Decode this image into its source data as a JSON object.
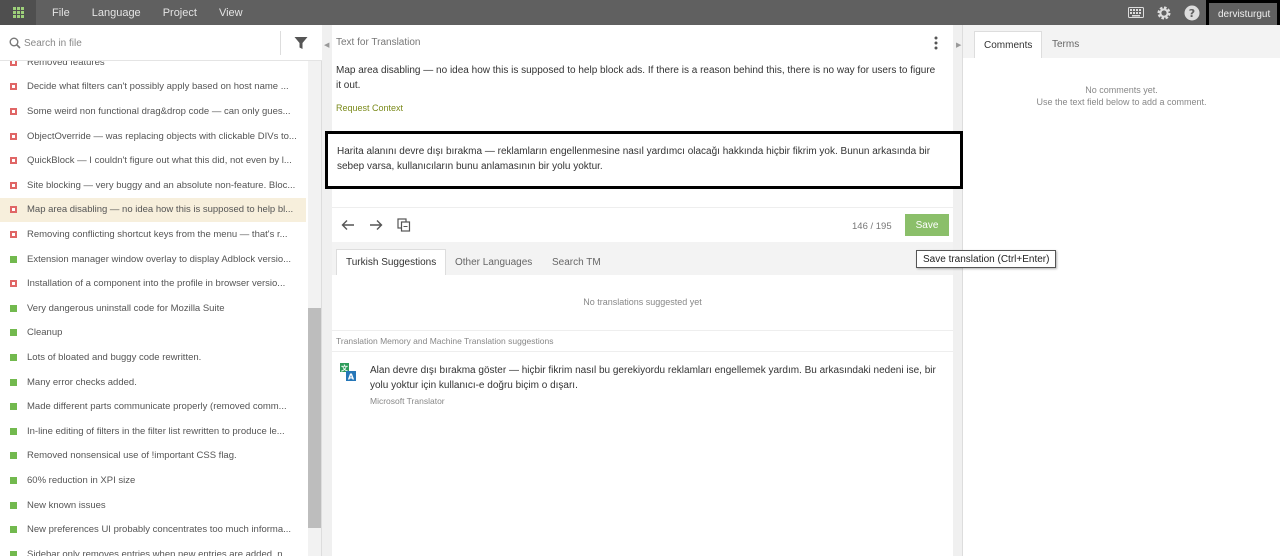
{
  "menu": [
    "File",
    "Language",
    "Project",
    "View"
  ],
  "user": {
    "name": "dervisturgut"
  },
  "colors": {
    "accent": "#8bbf6a",
    "topbar": "#606060",
    "error_dot": "#e06666",
    "ok_dot": "#72b94e"
  },
  "sidebar": {
    "search_placeholder": "Search in file",
    "items": [
      {
        "status": "error",
        "text": "Removed features"
      },
      {
        "status": "error",
        "text": "Decide what filters can't possibly apply based on host name ..."
      },
      {
        "status": "error",
        "text": "Some weird non functional drag&drop code — can only gues..."
      },
      {
        "status": "error",
        "text": "ObjectOverride — was replacing objects with clickable DIVs to..."
      },
      {
        "status": "error",
        "text": "QuickBlock — I couldn't figure out what this did, not even by l..."
      },
      {
        "status": "error",
        "text": "Site blocking — very buggy and an absolute non-feature. Bloc..."
      },
      {
        "status": "error",
        "text": "Map area disabling — no idea how this is supposed to help bl...",
        "selected": true
      },
      {
        "status": "error",
        "text": "Removing conflicting shortcut keys from the menu — that's r..."
      },
      {
        "status": "ok",
        "text": "Extension manager window overlay to display Adblock versio..."
      },
      {
        "status": "error",
        "text": "Installation of a component into the profile in browser versio..."
      },
      {
        "status": "ok",
        "text": "Very dangerous uninstall code for Mozilla Suite"
      },
      {
        "status": "ok",
        "text": "Cleanup"
      },
      {
        "status": "ok",
        "text": "Lots of bloated and buggy code rewritten."
      },
      {
        "status": "ok",
        "text": "Many error checks added."
      },
      {
        "status": "ok",
        "text": "Made different parts communicate properly (removed comm..."
      },
      {
        "status": "ok",
        "text": "In-line editing of filters in the filter list rewritten to produce le..."
      },
      {
        "status": "ok",
        "text": "Removed nonsensical use of !important CSS flag."
      },
      {
        "status": "ok",
        "text": "60% reduction in XPI size"
      },
      {
        "status": "ok",
        "text": "New known issues"
      },
      {
        "status": "ok",
        "text": "New preferences UI probably concentrates too much informa..."
      },
      {
        "status": "ok",
        "text": "Sidebar only removes entries when new entries are added, n..."
      }
    ]
  },
  "editor": {
    "source_header": "Text for Translation",
    "source_text": "Map area disabling — no idea how this is supposed to help block ads. If there is a reason behind this, there is no way for users to figure it out.",
    "request_context": "Request Context",
    "translation": "Harita alanını devre dışı bırakma — reklamların engellenmesine nasıl yardımcı olacağı hakkında hiçbir fikrim yok. Bunun arkasında bir sebep varsa, kullanıcıların bunu anlamasının bir yolu yoktur.",
    "counter": "146 / 195",
    "save_label": "Save",
    "save_tooltip": "Save translation (Ctrl+Enter)"
  },
  "suggestions": {
    "tabs": [
      "Turkish Suggestions",
      "Other Languages",
      "Search TM"
    ],
    "empty_text": "No translations suggested yet",
    "tm_header": "Translation Memory and Machine Translation suggestions",
    "mt_text": "Alan devre dışı bırakma göster — hiçbir fikrim nasıl bu gerekiyordu reklamları engellemek yardım. Bu arkasındaki nedeni ise, bir yolu yoktur için kullanıcı-e doğru biçim o dışarı.",
    "mt_source": "Microsoft Translator"
  },
  "comments": {
    "tabs": [
      "Comments",
      "Terms"
    ],
    "empty_line1": "No comments yet.",
    "empty_line2": "Use the text field below to add a comment."
  }
}
